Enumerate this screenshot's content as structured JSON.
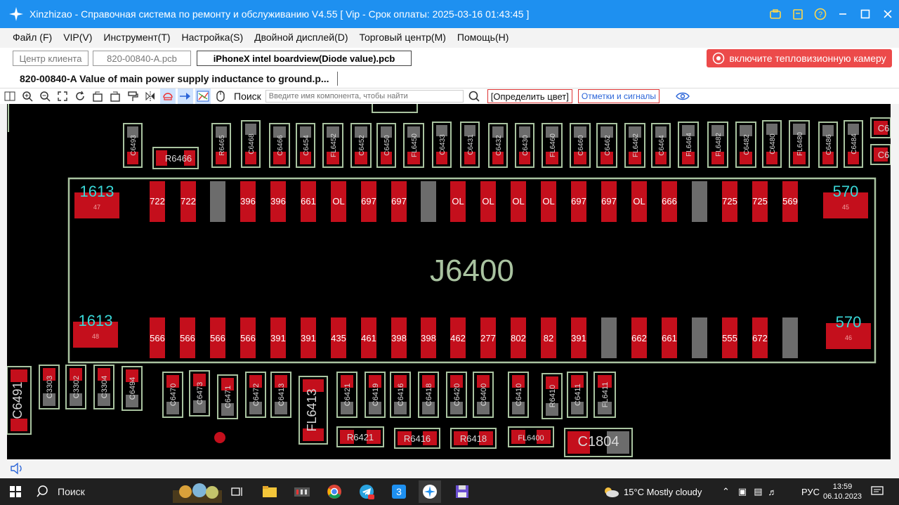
{
  "window": {
    "title": "Xinzhizao - Справочная система по ремонту и обслуживанию V4.55 [ Vip - Срок оплаты: 2025-03-16 01:43:45 ]"
  },
  "menu": [
    "Файл (F)",
    "VIP(V)",
    "Инструмент(T)",
    "Настройка(S)",
    "Двойной дисплей(D)",
    "Торговый центр(M)",
    "Помощь(H)"
  ],
  "file_tabs": [
    "Центр клиента",
    "820-00840-A.pcb",
    "iPhoneX intel  boardview(Diode value).pcb"
  ],
  "camera_button": "включите тепловизионную камеру",
  "document_tab": "820-00840-A Value of main power supply inductance to ground.p...",
  "toolbar": {
    "search_label": "Поиск",
    "search_placeholder": "Введите имя компонента, чтобы найти",
    "determine_color": "[Определить цвет]",
    "marks_signals": "Отметки и сигналы"
  },
  "board": {
    "connector": "J6400",
    "corner_labels": {
      "top_left": "1613",
      "top_left_pad": "47",
      "top_right": "570",
      "top_right_pad": "45",
      "bottom_left": "1613",
      "bottom_left_pad": "48",
      "bottom_right": "570",
      "bottom_right_pad": "46"
    },
    "top_pins": [
      "722",
      "722",
      "",
      "396",
      "396",
      "661",
      "OL",
      "697",
      "697",
      "",
      "OL",
      "OL",
      "OL",
      "OL",
      "697",
      "697",
      "OL",
      "666",
      "",
      "725",
      "725",
      "569"
    ],
    "bottom_pins": [
      "566",
      "566",
      "566",
      "566",
      "391",
      "391",
      "435",
      "461",
      "398",
      "398",
      "462",
      "277",
      "802",
      "82",
      "391",
      "",
      "662",
      "661",
      "",
      "555",
      "672",
      ""
    ],
    "top_components": [
      "C6493",
      "R6466",
      "R6465",
      "C6468",
      "C6466",
      "C6454",
      "FL6452",
      "C6452",
      "C6450",
      "FL6450",
      "C6433",
      "C6431",
      "C6432",
      "C6430",
      "FL6460",
      "C6460",
      "C6462",
      "FL6462",
      "C6464",
      "FL6464",
      "FL6482",
      "C6482",
      "C6480",
      "FL6480",
      "C6486",
      "C6484",
      "C6",
      "C6"
    ],
    "bottom_components": [
      "C6491",
      "C3303",
      "C3302",
      "C3304",
      "C6494",
      "C6470",
      "C6473",
      "C6471",
      "C6472",
      "C6413",
      "FL6413",
      "C6421",
      "C6419",
      "C6416",
      "C6418",
      "C6420",
      "C6400",
      "C6410",
      "R6410",
      "C6411",
      "FL6411",
      "R6421",
      "R6416",
      "R6418",
      "FL6400",
      "C1804"
    ]
  },
  "taskbar": {
    "search": "Поиск",
    "weather": "15°C  Mostly cloudy",
    "lang": "РУС",
    "time": "13:59",
    "date": "06.10.2023"
  }
}
